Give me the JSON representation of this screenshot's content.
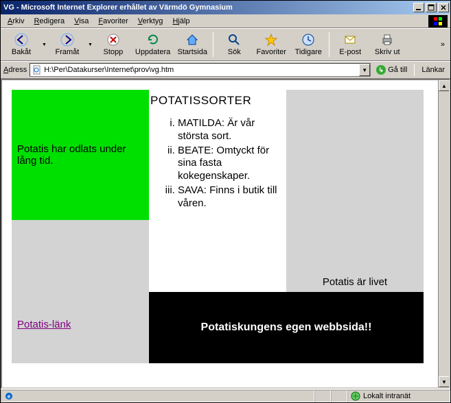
{
  "window": {
    "title": "VG - Microsoft Internet Explorer erhållet av Värmdö Gymnasium",
    "min": "_",
    "max": "❐",
    "close": "✕"
  },
  "menu": {
    "arkiv": "rkiv",
    "redigera": "edigera",
    "visa": "isa",
    "favoriter": "avoriter",
    "verktyg": "erktyg",
    "hjalp": "jälp"
  },
  "toolbar": {
    "back": "Bakåt",
    "forward": "Framåt",
    "stop": "Stopp",
    "refresh": "Uppdatera",
    "home": "Startsida",
    "search": "Sök",
    "favorites": "Favoriter",
    "history": "Tidigare",
    "mail": "E-post",
    "print": "Skriv ut",
    "overflow": "»"
  },
  "address": {
    "label_prefix": "A",
    "label_rest": "dress",
    "value": "H:\\Per\\Datakurser\\Internet\\prov\\vg.htm",
    "go": "Gå till",
    "links": "Länkar"
  },
  "page": {
    "green_text": "Potatis har odlats under lång tid.",
    "heading": "POTATISSORTER",
    "items": [
      "MATILDA: Är vår största sort.",
      "BEATE: Omtyckt för sina fasta kokegenskaper.",
      "SAVA: Finns i butik till våren."
    ],
    "link_text": "Potatis-länk",
    "motto": "Potatis är livet",
    "black_text": "Potatiskungens egen webbsida!!"
  },
  "status": {
    "zone": "Lokalt intranät"
  }
}
